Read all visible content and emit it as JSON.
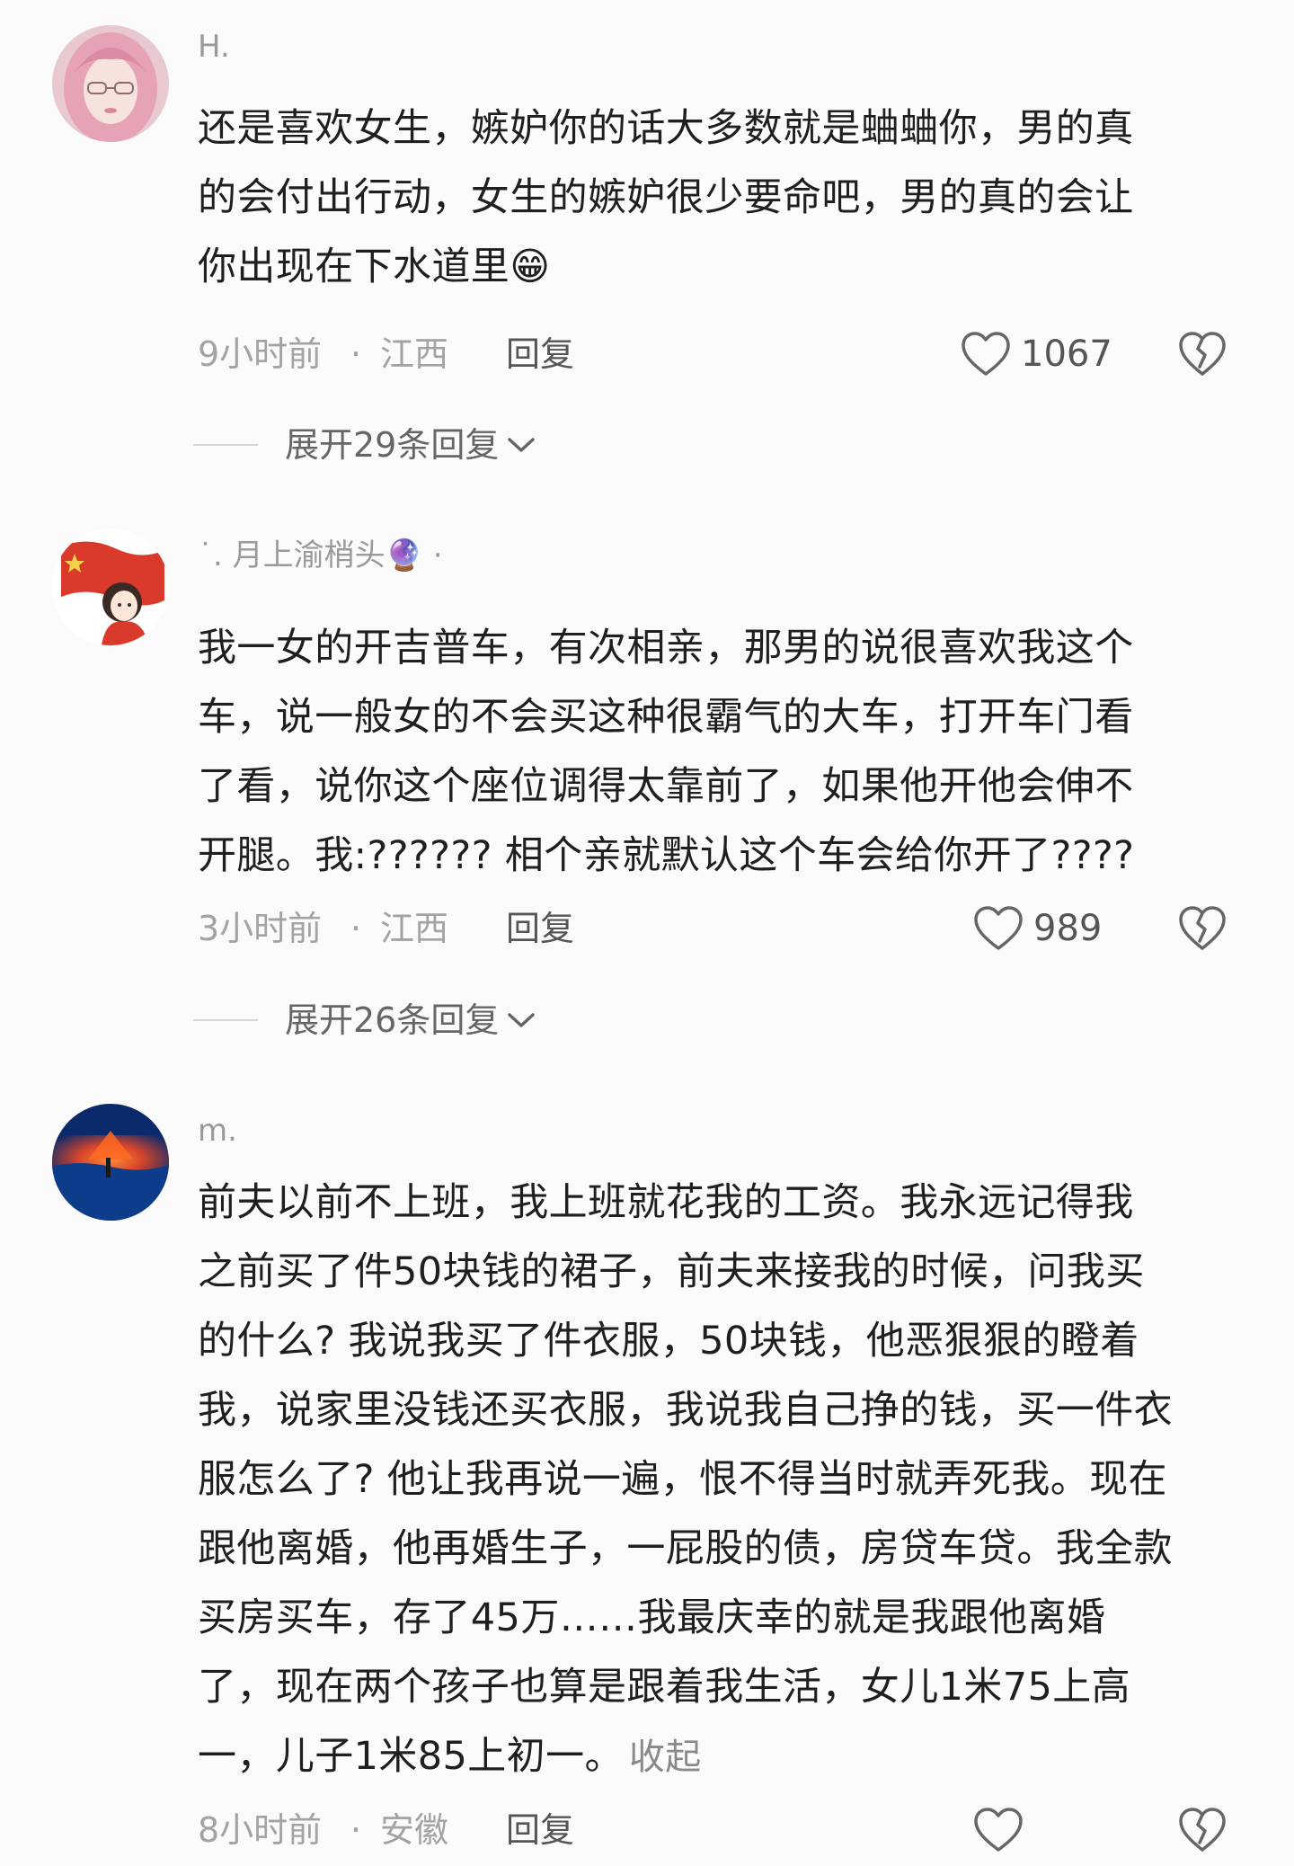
{
  "comments": [
    {
      "username": "H.",
      "content_lines": [
        "还是喜欢女生，嫉妒你的话大多数就是蛐蛐你，男的真",
        "的会付出行动，女生的嫉妒很少要命吧，男的真的会让",
        "你出现在下水道里"
      ],
      "emoji": "😁",
      "time": "9小时前",
      "location": "江西",
      "reply_label": "回复",
      "likes": "1067",
      "expand_label": "展开29条回复"
    },
    {
      "username_prefix": "˙.",
      "username": "月上渝梢头",
      "username_emoji": "🔮",
      "username_suffix": "·",
      "content_lines": [
        "我一女的开吉普车，有次相亲，那男的说很喜欢我这个",
        "车，说一般女的不会买这种很霸气的大车，打开车门看",
        "了看，说你这个座位调得太靠前了，如果他开他会伸不",
        "开腿。我:?????? 相个亲就默认这个车会给你开了????"
      ],
      "time": "3小时前",
      "location": "江西",
      "reply_label": "回复",
      "likes": "989",
      "expand_label": "展开26条回复"
    },
    {
      "username": "m.",
      "content_lines": [
        "前夫以前不上班，我上班就花我的工资。我永远记得我",
        "之前买了件50块钱的裙子，前夫来接我的时候，问我买",
        "的什么? 我说我买了件衣服，50块钱，他恶狠狠的瞪着",
        "我，说家里没钱还买衣服，我说我自己挣的钱，买一件衣",
        "服怎么了? 他让我再说一遍，恨不得当时就弄死我。现在",
        "跟他离婚，他再婚生子，一屁股的债，房贷车贷。我全款",
        "买房买车，存了45万……我最庆幸的就是我跟他离婚",
        "了，现在两个孩子也算是跟着我生活，女儿1米75上高",
        "一，儿子1米85上初一。"
      ],
      "collapse_label": "收起",
      "time": "8小时前",
      "location": "安徽",
      "reply_label": "回复"
    }
  ],
  "meta_dot": "·",
  "icons": {
    "like": "heart-outline-icon",
    "dislike": "broken-heart-icon",
    "expand": "chevron-down-icon"
  },
  "colors": {
    "background": "#fbfbfb",
    "text": "#1f1f1f",
    "muted": "#a3a3a3"
  }
}
